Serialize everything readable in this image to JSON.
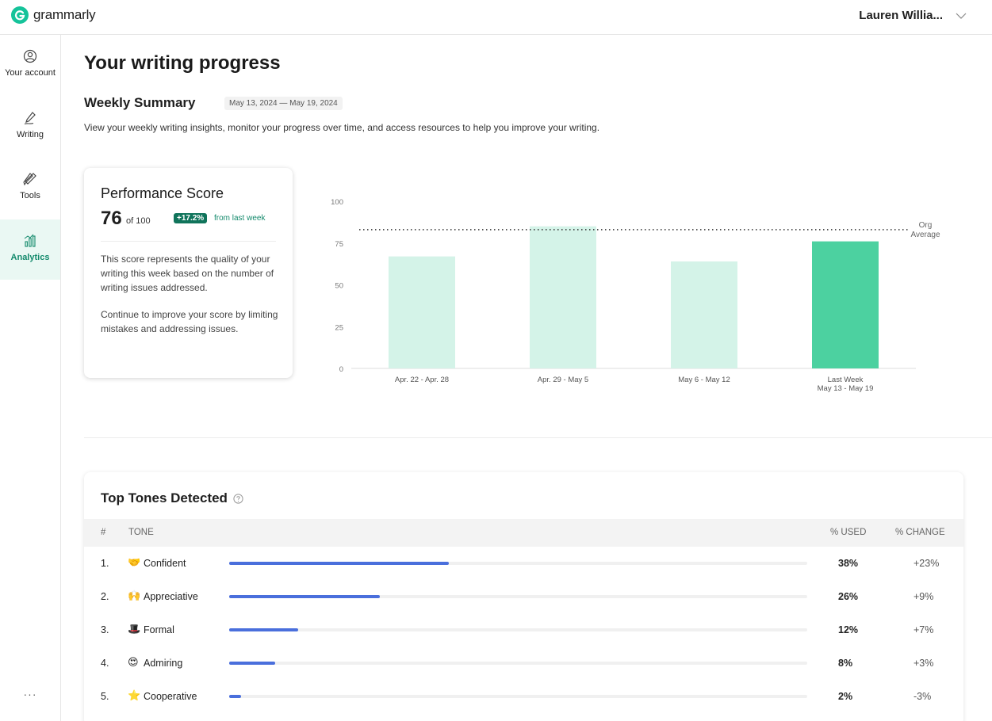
{
  "app": {
    "brand": "grammarly",
    "brand_color": "#15c39a"
  },
  "user": {
    "name": "Lauren Willia..."
  },
  "sidebar": {
    "items": [
      {
        "label": "Your account",
        "icon": "user-circle-icon"
      },
      {
        "label": "Writing",
        "icon": "pen-icon"
      },
      {
        "label": "Tools",
        "icon": "tools-icon"
      },
      {
        "label": "Analytics",
        "icon": "bar-chart-icon",
        "active": true
      }
    ],
    "more": "···"
  },
  "page": {
    "title": "Your writing progress",
    "summary_title": "Weekly Summary",
    "date_range": "May 13, 2024 — May 19, 2024",
    "intro": "View your weekly writing insights, monitor your progress over time, and access resources to help you improve your writing."
  },
  "performance": {
    "title": "Performance Score",
    "score": "76",
    "of": "of 100",
    "badge": "+17.2%",
    "from": "from last week",
    "text1": "This score represents the quality of your writing this week based on the number of writing issues addressed.",
    "text2": "Continue to improve your score by limiting mistakes and addressing issues."
  },
  "chart_data": {
    "type": "bar",
    "categories": [
      "Apr. 22 - Apr. 28",
      "Apr. 29 - May 5",
      "May 6 - May 12",
      "Last Week|May 13 - May 19"
    ],
    "values": [
      67,
      85,
      64,
      76
    ],
    "ylim": [
      0,
      100
    ],
    "yticks": [
      0,
      25,
      50,
      75,
      100
    ],
    "reference_line": {
      "value": 83,
      "label_line1": "Org",
      "label_line2": "Average"
    },
    "colors": {
      "default": "#d4f3e8",
      "highlight": "#4cd1a0"
    },
    "highlight_index": 3
  },
  "tones": {
    "title": "Top Tones Detected",
    "headers": {
      "num": "#",
      "tone": "TONE",
      "used": "% USED",
      "change": "% CHANGE"
    },
    "rows": [
      {
        "num": "1.",
        "emoji": "🤝",
        "name": "Confident",
        "used": "38%",
        "fraction": 0.38,
        "change": "+23%"
      },
      {
        "num": "2.",
        "emoji": "🙌",
        "name": "Appreciative",
        "used": "26%",
        "fraction": 0.26,
        "change": "+9%"
      },
      {
        "num": "3.",
        "emoji": "🎩",
        "name": "Formal",
        "used": "12%",
        "fraction": 0.12,
        "change": "+7%"
      },
      {
        "num": "4.",
        "emoji": "😍",
        "name": "Admiring",
        "used": "8%",
        "fraction": 0.08,
        "change": "+3%"
      },
      {
        "num": "5.",
        "emoji": "⭐",
        "name": "Cooperative",
        "used": "2%",
        "fraction": 0.02,
        "change": "-3%"
      }
    ],
    "bar_color": "#4a6fdc"
  }
}
